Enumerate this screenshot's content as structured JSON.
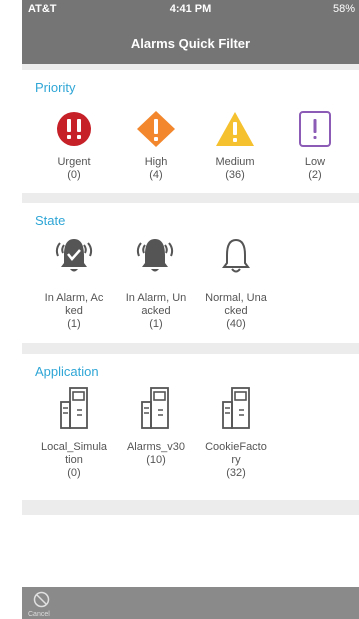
{
  "statusbar": {
    "carrier": "AT&T",
    "time": "4:41 PM",
    "battery": "58%"
  },
  "header": {
    "title": "Alarms Quick Filter"
  },
  "priority": {
    "heading": "Priority",
    "items": [
      {
        "label": "Urgent",
        "count": "(0)",
        "icon": "urgent-icon",
        "color": "#c62028"
      },
      {
        "label": "High",
        "count": "(4)",
        "icon": "high-icon",
        "color": "#f2872d"
      },
      {
        "label": "Medium",
        "count": "(36)",
        "icon": "medium-icon",
        "color": "#f5c12e"
      },
      {
        "label": "Low",
        "count": "(2)",
        "icon": "low-icon",
        "color": "#8b5bb5"
      }
    ]
  },
  "state": {
    "heading": "State",
    "items": [
      {
        "label_line1": "In Alarm, Ac",
        "label_line2": "ked",
        "count": "(1)",
        "icon": "bell-acked-icon"
      },
      {
        "label_line1": "In Alarm, Un",
        "label_line2": "acked",
        "count": "(1)",
        "icon": "bell-ringing-icon"
      },
      {
        "label_line1": "Normal, Una",
        "label_line2": "cked",
        "count": "(40)",
        "icon": "bell-outline-icon"
      }
    ]
  },
  "application": {
    "heading": "Application",
    "items": [
      {
        "label_line1": "Local_Simula",
        "label_line2": "tion",
        "count": "(0)",
        "icon": "server-icon"
      },
      {
        "label_line1": "Alarms_v30",
        "label_line2": "",
        "count": "(10)",
        "icon": "server-icon"
      },
      {
        "label_line1": "CookieFacto",
        "label_line2": "ry",
        "count": "(32)",
        "icon": "server-icon"
      }
    ]
  },
  "footer": {
    "cancel_label": "Cancel",
    "cancel_icon": "cancel-icon"
  },
  "colors": {
    "accent": "#2fa6d6",
    "bar": "#757575"
  }
}
